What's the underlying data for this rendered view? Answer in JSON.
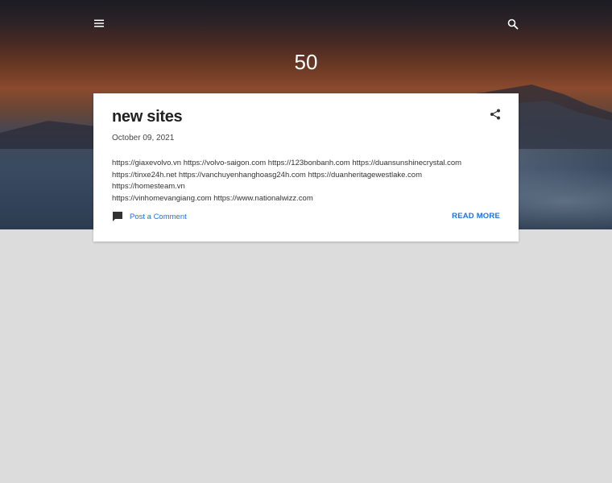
{
  "header": {
    "blog_title": "50",
    "menu_icon": "hamburger-menu-icon",
    "search_icon": "search-icon"
  },
  "post": {
    "title": "new sites",
    "date": "October 09, 2021",
    "body_lines": [
      "https://giaxevolvo.vn https://volvo-saigon.com https://123bonbanh.com https://duansunshinecrystal.com",
      "https://tinxe24h.net https://vanchuyenhanghoasg24h.com https://duanheritagewestlake.com https://homesteam.vn",
      "https://vinhomevangiang.com https://www.nationalwizz.com"
    ],
    "share_icon": "share-icon",
    "comment_icon": "comment-icon",
    "comment_label": "Post a Comment",
    "read_more_label": "READ MORE"
  },
  "colors": {
    "link": "#1a73e8",
    "page_background": "#dcdcdc",
    "card_background": "#ffffff"
  }
}
